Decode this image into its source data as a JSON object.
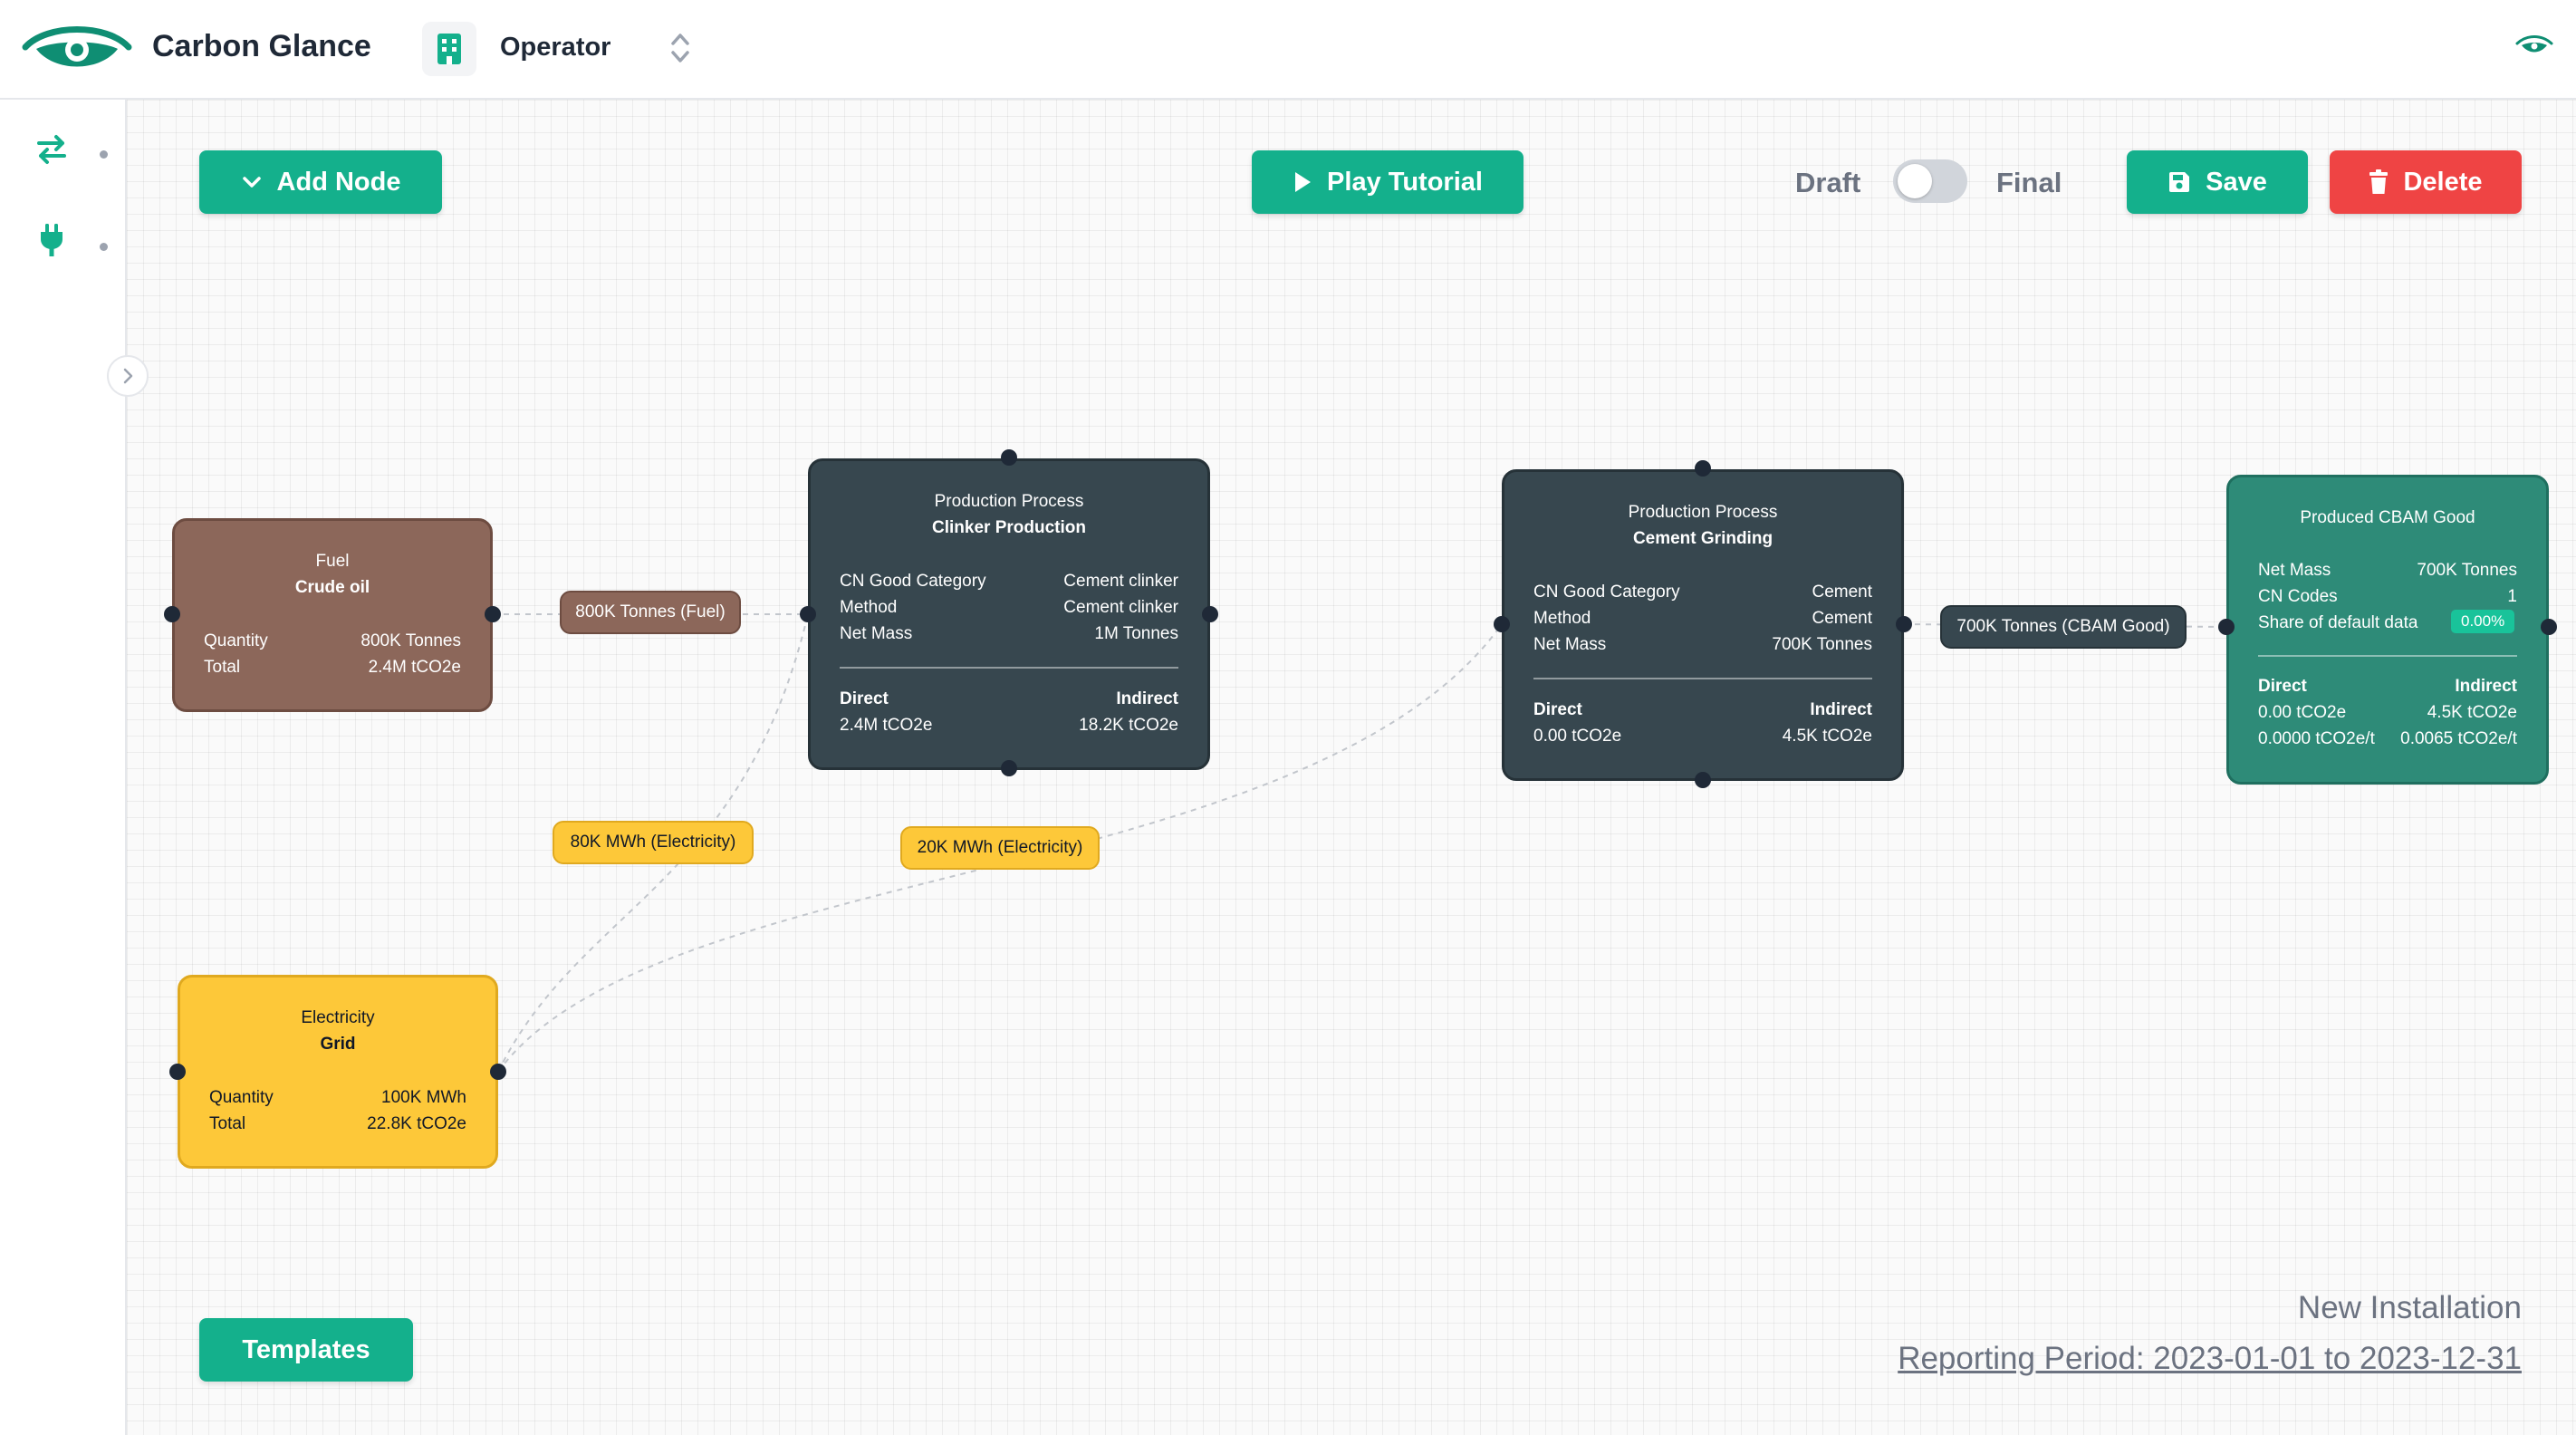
{
  "app": {
    "title": "Carbon Glance"
  },
  "organization": {
    "name": "Operator"
  },
  "toolbar": {
    "add_node_label": "Add Node",
    "play_tutorial_label": "Play Tutorial",
    "status_draft_label": "Draft",
    "status_final_label": "Final",
    "status_is_final": false,
    "save_label": "Save",
    "delete_label": "Delete",
    "templates_label": "Templates"
  },
  "nodes": {
    "fuel": {
      "type": "Fuel",
      "name": "Crude oil",
      "quantity_label": "Quantity",
      "quantity": "800K Tonnes",
      "total_label": "Total",
      "total": "2.4M tCO2e"
    },
    "clinker": {
      "type": "Production Process",
      "name": "Clinker Production",
      "cn_label": "CN Good Category",
      "cn": "Cement clinker",
      "method_label": "Method",
      "method": "Cement clinker",
      "mass_label": "Net Mass",
      "mass": "1M Tonnes",
      "direct_label": "Direct",
      "direct": "2.4M tCO2e",
      "indirect_label": "Indirect",
      "indirect": "18.2K tCO2e"
    },
    "grinding": {
      "type": "Production Process",
      "name": "Cement Grinding",
      "cn_label": "CN Good Category",
      "cn": "Cement",
      "method_label": "Method",
      "method": "Cement",
      "mass_label": "Net Mass",
      "mass": "700K Tonnes",
      "direct_label": "Direct",
      "direct": "0.00 tCO2e",
      "indirect_label": "Indirect",
      "indirect": "4.5K tCO2e"
    },
    "cbam": {
      "type": "Produced CBAM Good",
      "mass_label": "Net Mass",
      "mass": "700K Tonnes",
      "cn_codes_label": "CN Codes",
      "cn_codes": "1",
      "default_share_label": "Share of default data",
      "default_share": "0.00%",
      "direct_label": "Direct",
      "direct": "0.00 tCO2e",
      "direct_specific": "0.0000 tCO2e/t",
      "indirect_label": "Indirect",
      "indirect": "4.5K tCO2e",
      "indirect_specific": "0.0065 tCO2e/t"
    },
    "electricity": {
      "type": "Electricity",
      "name": "Grid",
      "quantity_label": "Quantity",
      "quantity": "100K MWh",
      "total_label": "Total",
      "total": "22.8K tCO2e"
    }
  },
  "edges": {
    "fuel_to_clinker": "800K Tonnes (Fuel)",
    "grid_to_clinker": "80K MWh (Electricity)",
    "grid_to_grinding": "20K MWh (Electricity)",
    "grinding_to_cbam": "700K Tonnes (CBAM Good)"
  },
  "footer": {
    "installation": "New Installation",
    "reporting_period": "Reporting Period: 2023-01-01 to 2023-12-31"
  },
  "colors": {
    "accent": "#14b08c",
    "danger": "#ef4444",
    "fuel": "#8c675a",
    "process": "#37474f",
    "cbam_good": "#2e8b78",
    "electricity": "#fdc839"
  },
  "icons": {
    "logo": "eye-logo-icon",
    "organization": "building-icon",
    "switch": "chevron-up-down-icon",
    "top_right": "eye-icon",
    "sidebar": [
      "swap-arrows-icon",
      "plug-icon"
    ],
    "collapse": "chevron-right-icon",
    "add_node": "chevron-down-icon",
    "play": "play-icon",
    "save": "floppy-disk-icon",
    "delete": "trash-icon"
  }
}
